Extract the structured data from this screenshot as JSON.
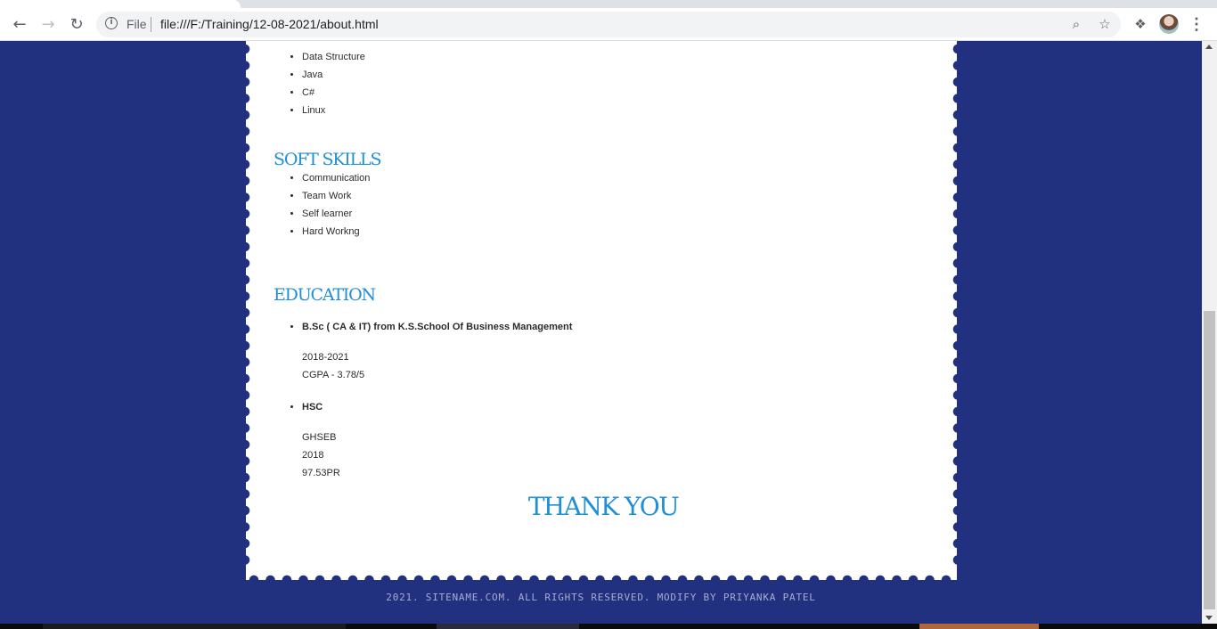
{
  "browser": {
    "url_scheme": "File",
    "url": "file:///F:/Training/12-08-2021/about.html",
    "icons": {
      "back": "arrow-left-icon",
      "forward": "arrow-right-icon",
      "reload": "reload-icon",
      "info": "info-icon",
      "zoom": "zoom-icon",
      "bookmark": "star-icon",
      "extensions": "puzzle-icon",
      "menu": "kebab-menu-icon"
    }
  },
  "technical": {
    "items": [
      "Data Structure",
      "Java",
      "C#",
      "Linux"
    ]
  },
  "soft_skills": {
    "title": "SOFT SKILLS",
    "items": [
      "Communication",
      "Team Work",
      "Self learner",
      "Hard Workng"
    ]
  },
  "education": {
    "title": "EDUCATION",
    "entries": [
      {
        "heading": "B.Sc ( CA & IT) from K.S.School Of Business Management",
        "lines": [
          "2018-2021",
          "CGPA - 3.78/5"
        ]
      },
      {
        "heading": "HSC",
        "lines": [
          "GHSEB",
          "2018",
          "97.53PR"
        ]
      }
    ]
  },
  "thank_you": "THANK YOU",
  "footer": "2021. SITENAME.COM. ALL RIGHTS RESERVED. MODIFY BY PRIYANKA PATEL",
  "colors": {
    "page_bg": "#22317f",
    "accent": "#1f8fd6",
    "footer_text": "#a6acd0"
  }
}
